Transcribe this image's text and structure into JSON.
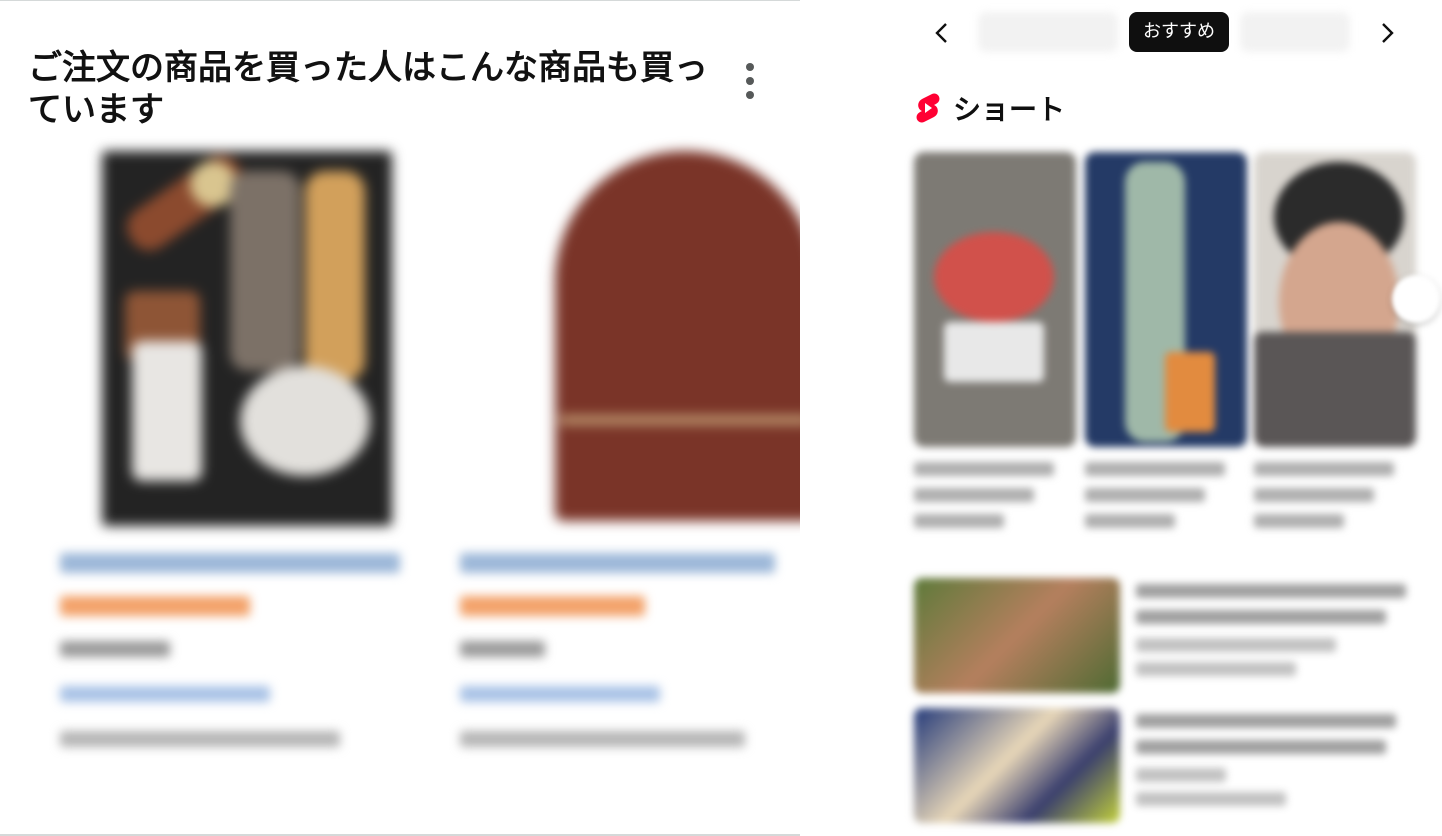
{
  "recommendations": {
    "title": "ご注文の商品を買った人はこんな商品も買っています",
    "more_icon": "kebab-vertical-icon"
  },
  "youtube": {
    "chips": {
      "prev_icon": "chevron-left-icon",
      "next_icon": "chevron-right-icon",
      "active_label": "おすすめ"
    },
    "shorts": {
      "logo_icon": "youtube-shorts-icon",
      "title": "ショート",
      "next_icon": "chevron-right-icon"
    }
  },
  "colors": {
    "shorts_red": "#ff0033",
    "chip_active_bg": "#0f0f0f",
    "heading_text": "#111111"
  }
}
